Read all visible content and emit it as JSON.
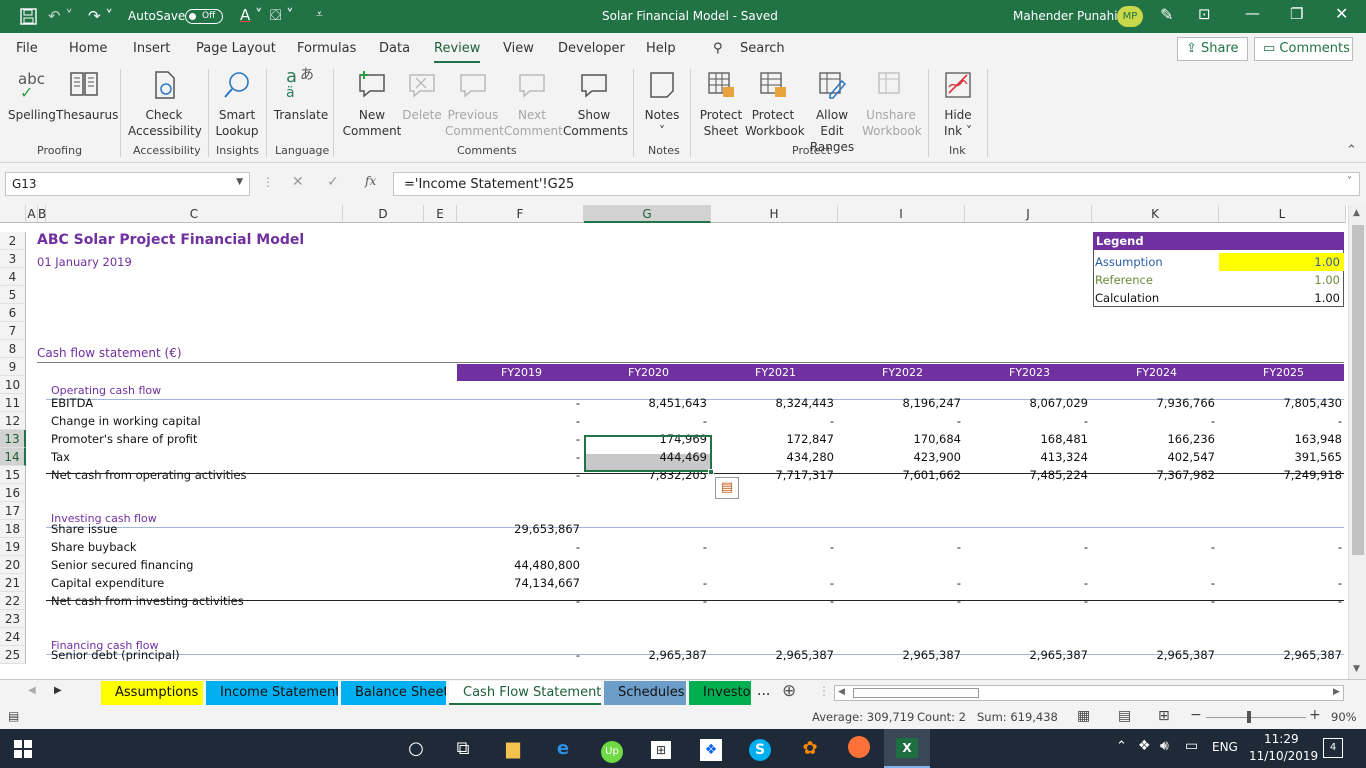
{
  "titlebar": {
    "autosave_label": "AutoSave",
    "autosave_state": "Off",
    "title": "Solar Financial Model  -  Saved",
    "user": "Mahender Punahi",
    "initials": "MP"
  },
  "menu": {
    "items": [
      "File",
      "Home",
      "Insert",
      "Page Layout",
      "Formulas",
      "Data",
      "Review",
      "View",
      "Developer",
      "Help"
    ],
    "active": "Review",
    "search": "Search",
    "share": "Share",
    "comments": "Comments"
  },
  "ribbon": {
    "spelling": "Spelling",
    "thesaurus": "Thesaurus",
    "abc": "abc",
    "check_1": "Check",
    "check_2": "Accessibility",
    "smart_1": "Smart",
    "smart_2": "Lookup",
    "translate": "Translate",
    "new_1": "New",
    "new_2": "Comment",
    "delete": "Delete",
    "prev_1": "Previous",
    "prev_2": "Comment",
    "next_1": "Next",
    "next_2": "Comment",
    "show_1": "Show",
    "show_2": "Comments",
    "notes": "Notes",
    "psheet_1": "Protect",
    "psheet_2": "Sheet",
    "pwb_1": "Protect",
    "pwb_2": "Workbook",
    "allow_1": "Allow Edit",
    "allow_2": "Ranges",
    "unshare_1": "Unshare",
    "unshare_2": "Workbook",
    "hide_1": "Hide",
    "hide_2": "Ink ˅",
    "groups": {
      "proofing": "Proofing",
      "accessibility": "Accessibility",
      "insights": "Insights",
      "language": "Language",
      "comments": "Comments",
      "notes": "Notes",
      "protect": "Protect",
      "ink": "Ink"
    }
  },
  "formula_bar": {
    "namebox": "G13",
    "formula": "='Income Statement'!G25"
  },
  "columns": [
    "A",
    "B",
    "C",
    "D",
    "E",
    "F",
    "G",
    "H",
    "I",
    "J",
    "K",
    "L"
  ],
  "rows": [
    "2",
    "3",
    "4",
    "5",
    "6",
    "7",
    "8",
    "9",
    "10",
    "11",
    "12",
    "13",
    "14",
    "15",
    "16",
    "17",
    "18",
    "19",
    "20",
    "21",
    "22",
    "23",
    "24",
    "25"
  ],
  "sheet": {
    "title": "ABC Solar Project Financial Model",
    "date": "01 January 2019",
    "legend": {
      "header": "Legend",
      "assumption": "Assumption",
      "assumption_v": "1.00",
      "reference": "Reference",
      "reference_v": "1.00",
      "calculation": "Calculation",
      "calculation_v": "1.00"
    },
    "section": "Cash flow statement (€)",
    "years": [
      "FY2019",
      "FY2020",
      "FY2021",
      "FY2022",
      "FY2023",
      "FY2024",
      "FY2025"
    ],
    "op_header": "Operating cash flow",
    "inv_header": "Investing cash flow",
    "fin_header": "Financing cash flow",
    "lines": [
      {
        "label": "EBITDA",
        "values": [
          "-",
          "8,451,643",
          "8,324,443",
          "8,196,247",
          "8,067,029",
          "7,936,766",
          "7,805,430"
        ]
      },
      {
        "label": "Change in working capital",
        "values": [
          "-",
          "-",
          "-",
          "-",
          "-",
          "-",
          "-"
        ]
      },
      {
        "label": "Promoter's share of profit",
        "values": [
          "-",
          "174,969",
          "172,847",
          "170,684",
          "168,481",
          "166,236",
          "163,948"
        ]
      },
      {
        "label": "Tax",
        "values": [
          "-",
          "444,469",
          "434,280",
          "423,900",
          "413,324",
          "402,547",
          "391,565"
        ]
      },
      {
        "label": "Net cash from operating activities",
        "values": [
          "-",
          "7,832,205",
          "7,717,317",
          "7,601,662",
          "7,485,224",
          "7,367,982",
          "7,249,918"
        ]
      },
      {
        "label": "Share issue",
        "values": [
          "29,653,867",
          "",
          "",
          "",
          "",
          "",
          ""
        ]
      },
      {
        "label": "Share buyback",
        "values": [
          "-",
          "-",
          "-",
          "-",
          "-",
          "-",
          "-"
        ]
      },
      {
        "label": "Senior secured financing",
        "values": [
          "44,480,800",
          "",
          "",
          "",
          "",
          "",
          ""
        ]
      },
      {
        "label": "Capital expenditure",
        "values": [
          "74,134,667",
          "-",
          "-",
          "-",
          "-",
          "-",
          "-"
        ]
      },
      {
        "label": "Net cash from investing activities",
        "values": [
          "-",
          "-",
          "-",
          "-",
          "-",
          "-",
          "-"
        ]
      },
      {
        "label": "Senior debt (principal)",
        "values": [
          "-",
          "2,965,387",
          "2,965,387",
          "2,965,387",
          "2,965,387",
          "2,965,387",
          "2,965,387"
        ]
      }
    ]
  },
  "tabs": [
    {
      "label": "Assumptions",
      "bg": "#ffff00",
      "fg": "#111111"
    },
    {
      "label": "Income Statement",
      "bg": "#00b0f0",
      "fg": "#111111"
    },
    {
      "label": "Balance Sheet",
      "bg": "#00b0f0",
      "fg": "#111111"
    },
    {
      "label": "Cash Flow Statement",
      "bg": "#ffffff",
      "fg": "#1e5e38"
    },
    {
      "label": "Schedules",
      "bg": "#6d9eca",
      "fg": "#111111"
    },
    {
      "label": "Investor",
      "bg": "#00b050",
      "fg": "#111111"
    }
  ],
  "tabs_more": "...",
  "status": {
    "average": "Average: 309,719",
    "count": "Count: 2",
    "sum": "Sum: 619,438",
    "zoom": "90%"
  },
  "taskbar": {
    "lang": "ENG",
    "time": "11:29",
    "date": "11/10/2019",
    "notif": "4"
  },
  "colors": {
    "excel_green": "#217346",
    "purple": "#7030a0",
    "assumption_yellow": "#ffff00"
  }
}
